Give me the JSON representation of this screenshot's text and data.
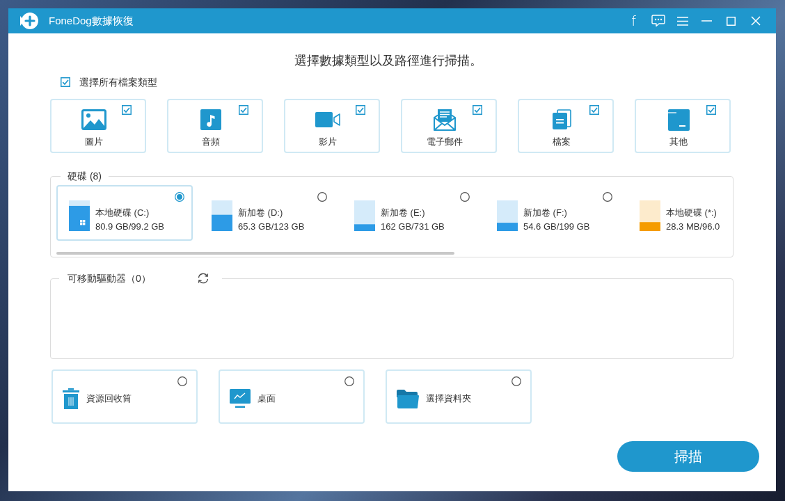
{
  "window": {
    "title": "FoneDog數據恢復",
    "social_button": "f"
  },
  "heading": "選擇數據類型以及路徑進行掃描。",
  "select_all": {
    "label": "選擇所有檔案類型",
    "checked": true
  },
  "file_types": [
    {
      "kind": "image",
      "label": "圖片",
      "checked": true
    },
    {
      "kind": "audio",
      "label": "音頻",
      "checked": true
    },
    {
      "kind": "video",
      "label": "影片",
      "checked": true
    },
    {
      "kind": "email",
      "label": "電子郵件",
      "checked": true
    },
    {
      "kind": "document",
      "label": "檔案",
      "checked": true
    },
    {
      "kind": "other",
      "label": "其他",
      "checked": true
    }
  ],
  "hard_drives": {
    "title": "硬碟 (8)",
    "drives": [
      {
        "kind": "system",
        "name": "本地硬碟 (C:)",
        "usage": "80.9 GB/99.2 GB",
        "level": 0.82,
        "color": "#2d9be6",
        "selected": true
      },
      {
        "kind": "volume",
        "name": "新加卷 (D:)",
        "usage": "65.3 GB/123 GB",
        "level": 0.53,
        "color": "#2d9be6",
        "selected": false
      },
      {
        "kind": "volume",
        "name": "新加卷 (E:)",
        "usage": "162 GB/731 GB",
        "level": 0.22,
        "color": "#2d9be6",
        "selected": false
      },
      {
        "kind": "volume",
        "name": "新加卷 (F:)",
        "usage": "54.6 GB/199 GB",
        "level": 0.27,
        "color": "#2d9be6",
        "selected": false
      },
      {
        "kind": "volume",
        "name": "本地硬碟 (*:)",
        "usage": "28.3 MB/96.0",
        "level": 0.29,
        "color": "#f59c00",
        "selected": false
      }
    ]
  },
  "removable_drives": {
    "title": "可移動驅動器（0）"
  },
  "locations": [
    {
      "kind": "recycle_bin",
      "label": "資源回收筒",
      "selected": false
    },
    {
      "kind": "desktop",
      "label": "桌面",
      "selected": false
    },
    {
      "kind": "folder",
      "label": "選擇資料夾",
      "selected": false
    }
  ],
  "scan_button": "掃描"
}
